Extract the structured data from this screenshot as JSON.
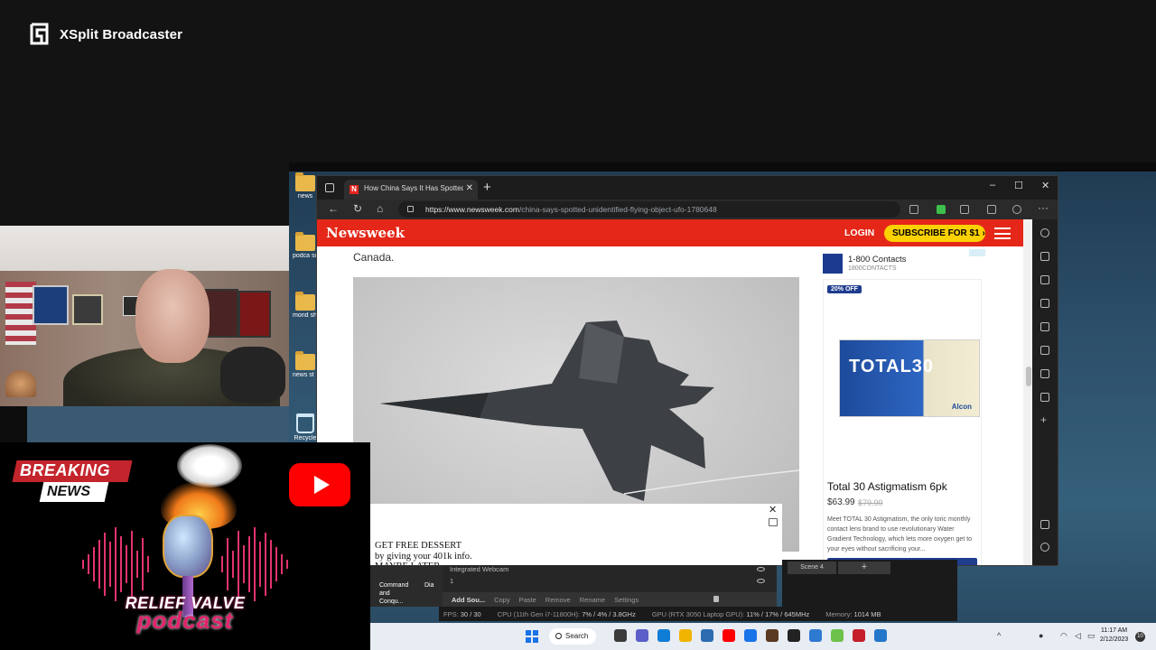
{
  "xsplit": {
    "brand": "XSplit Broadcaster"
  },
  "desktop": {
    "icons": [
      {
        "label": "news"
      },
      {
        "label": "podca sourc"
      },
      {
        "label": "mond show"
      },
      {
        "label": "news st links"
      },
      {
        "label": "Recycle"
      }
    ]
  },
  "browser": {
    "tab_title": "How China Says It Has Spotted a",
    "tab_favicon": "N",
    "new_tab": "+",
    "url_host": "https://www.newsweek.com",
    "url_path": "/china-says-spotted-unidentified-flying-object-ufo-1780648",
    "window_controls": [
      "–",
      "☐",
      "✕"
    ]
  },
  "newsweek": {
    "logo": "Newsweek",
    "login": "LOGIN",
    "subscribe": "SUBSCRIBE FOR $1 ›",
    "article_text": "Canada."
  },
  "ad": {
    "brand": "1-800 Contacts",
    "brand_sub": "1800CONTACTS",
    "badge": "20% OFF",
    "box_text": "TOTAL30",
    "box_maker": "Alcon",
    "product": "Total 30 Astigmatism 6pk",
    "price": "$63.99",
    "old_price": "$79.99",
    "description": "Meet TOTAL 30 Astigmatism, the only toric monthly contact lens brand to use revolutionary Water Gradient Technology, which lets more oxygen get to your eyes without sacrificing your..."
  },
  "float_ad": {
    "line1": "GET FREE DESSERT",
    "line2": "by giving your 401k info.",
    "line3": "MAYBE LATER",
    "close": "✕"
  },
  "xsplit_panel": {
    "sources": [
      "Integrated Webcam",
      "1"
    ],
    "actions": [
      "Add Sou...",
      "Copy",
      "Paste",
      "Remove",
      "Rename",
      "Settings"
    ],
    "scene": "Scene 4",
    "scene_add": "+",
    "taskbar_apps": [
      "Command and Conqu...",
      "Dia"
    ]
  },
  "stats": {
    "fps_label": "FPS:",
    "fps": "30 / 30",
    "cpu_label": "CPU (11th Gen i7-11800H):",
    "cpu": "7% / 4% / 3.8GHz",
    "gpu_label": "GPU (RTX 3050 Laptop GPU):",
    "gpu": "11% / 17% / 645MHz",
    "mem_label": "Memory:",
    "mem": "1014 MB"
  },
  "taskbar": {
    "search": "Search",
    "time": "11:17 AM",
    "date": "2/12/2023",
    "notifications": "10",
    "app_colors": [
      "#3b3b3b",
      "#5b5fc7",
      "#0f7dd6",
      "#f0b400",
      "#2b6cb0",
      "#ff0000",
      "#1a73e8",
      "#5a3a20",
      "#222222",
      "#2f7ad1",
      "#6cc24a",
      "#c41f2a",
      "#2477c9"
    ]
  },
  "promo": {
    "breaking": "BREAKING",
    "news": "NEWS",
    "title": "RELIEF VALVE",
    "subtitle": "podcast"
  }
}
